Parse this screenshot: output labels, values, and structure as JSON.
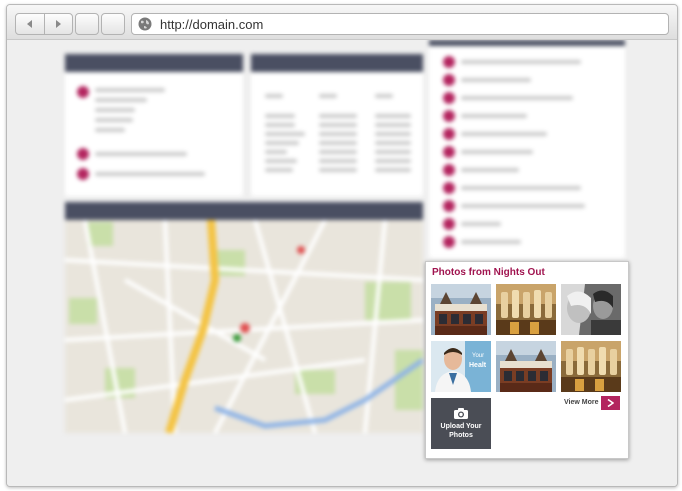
{
  "browser": {
    "url": "http://domain.com",
    "icons": {
      "back": "back-arrow-icon",
      "forward": "forward-arrow-icon",
      "site": "globe-icon"
    }
  },
  "widget": {
    "title": "Photos from Nights Out",
    "upload_label": "Upload Your Photos",
    "view_more": "View More",
    "thumbnails": [
      "pub-exterior",
      "beer-taps",
      "laughing-women",
      "doctor-health-ad",
      "pub-exterior",
      "beer-taps"
    ],
    "icons": {
      "camera": "camera-icon",
      "next": "chevron-right-icon"
    }
  },
  "colors": {
    "accent": "#b3255f",
    "title": "#a0144f",
    "header_bar": "#4a4f62",
    "upload_tile": "#4a4d55"
  }
}
